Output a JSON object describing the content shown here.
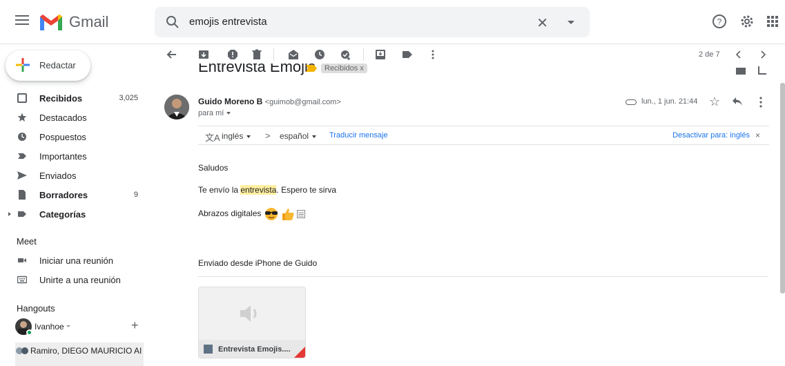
{
  "colors": {
    "accent_blue": "#1a73e8",
    "highlight": "#ffef9f",
    "online": "#0f9d58",
    "gmail_red": "#ea4335"
  },
  "header": {
    "app_name": "Gmail",
    "search": {
      "value": "emojis entrevista"
    },
    "icons": [
      "menu-icon",
      "gmail-logo",
      "search-icon",
      "clear-icon",
      "search-options-icon",
      "help-icon",
      "settings-icon",
      "apps-icon"
    ]
  },
  "sidebar": {
    "compose_label": "Redactar",
    "items": [
      {
        "label": "Recibidos",
        "count": "3,025",
        "icon": "inbox-icon",
        "bold": true
      },
      {
        "label": "Destacados",
        "count": "",
        "icon": "star-icon",
        "bold": false
      },
      {
        "label": "Pospuestos",
        "count": "",
        "icon": "clock-icon",
        "bold": false
      },
      {
        "label": "Importantes",
        "count": "",
        "icon": "important-icon",
        "bold": false
      },
      {
        "label": "Enviados",
        "count": "",
        "icon": "send-icon",
        "bold": false
      },
      {
        "label": "Borradores",
        "count": "9",
        "icon": "draft-icon",
        "bold": true
      },
      {
        "label": "Categorías",
        "count": "",
        "icon": "label-icon",
        "bold": true
      }
    ],
    "meet": {
      "title": "Meet",
      "items": [
        {
          "label": "Iniciar una reunión",
          "icon": "video-icon"
        },
        {
          "label": "Unirte a una reunión",
          "icon": "keyboard-icon"
        }
      ]
    },
    "hangouts": {
      "title": "Hangouts",
      "user": "Ivanhoe",
      "contacts": [
        "Ramiro, DIEGO MAURICIO AI"
      ]
    }
  },
  "toolbar": {
    "pager": "2 de 7",
    "icons": [
      "back-icon",
      "archive-icon",
      "spam-icon",
      "delete-icon",
      "mark-unread-icon",
      "snooze-icon",
      "add-task-icon",
      "move-to-icon",
      "labels-icon",
      "more-icon",
      "prev-icon",
      "next-icon"
    ]
  },
  "thread": {
    "subject": "Entrevista Emojis",
    "label_chip": "Recibidos x"
  },
  "message": {
    "sender_name": "Guido Moreno B",
    "sender_email": "<guimob@gmail.com>",
    "to": "para mí",
    "date": "lun., 1 jun. 21:44",
    "translate": {
      "from": "inglés",
      "arrow": ">",
      "to": "español",
      "link": "Traducir mensaje",
      "disable": "Desactivar para: inglés",
      "close": "×"
    },
    "body": {
      "greeting": "Saludos",
      "line2_pre": "Te envío la ",
      "line2_hl": "entrevista",
      "line2_post": ". Espero te sirva",
      "line3": "Abrazos digitales",
      "signature": "Enviado desde iPhone de Guido"
    },
    "attachment": {
      "name": "Entrevista Emojis....",
      "icon": "audio-icon"
    }
  }
}
